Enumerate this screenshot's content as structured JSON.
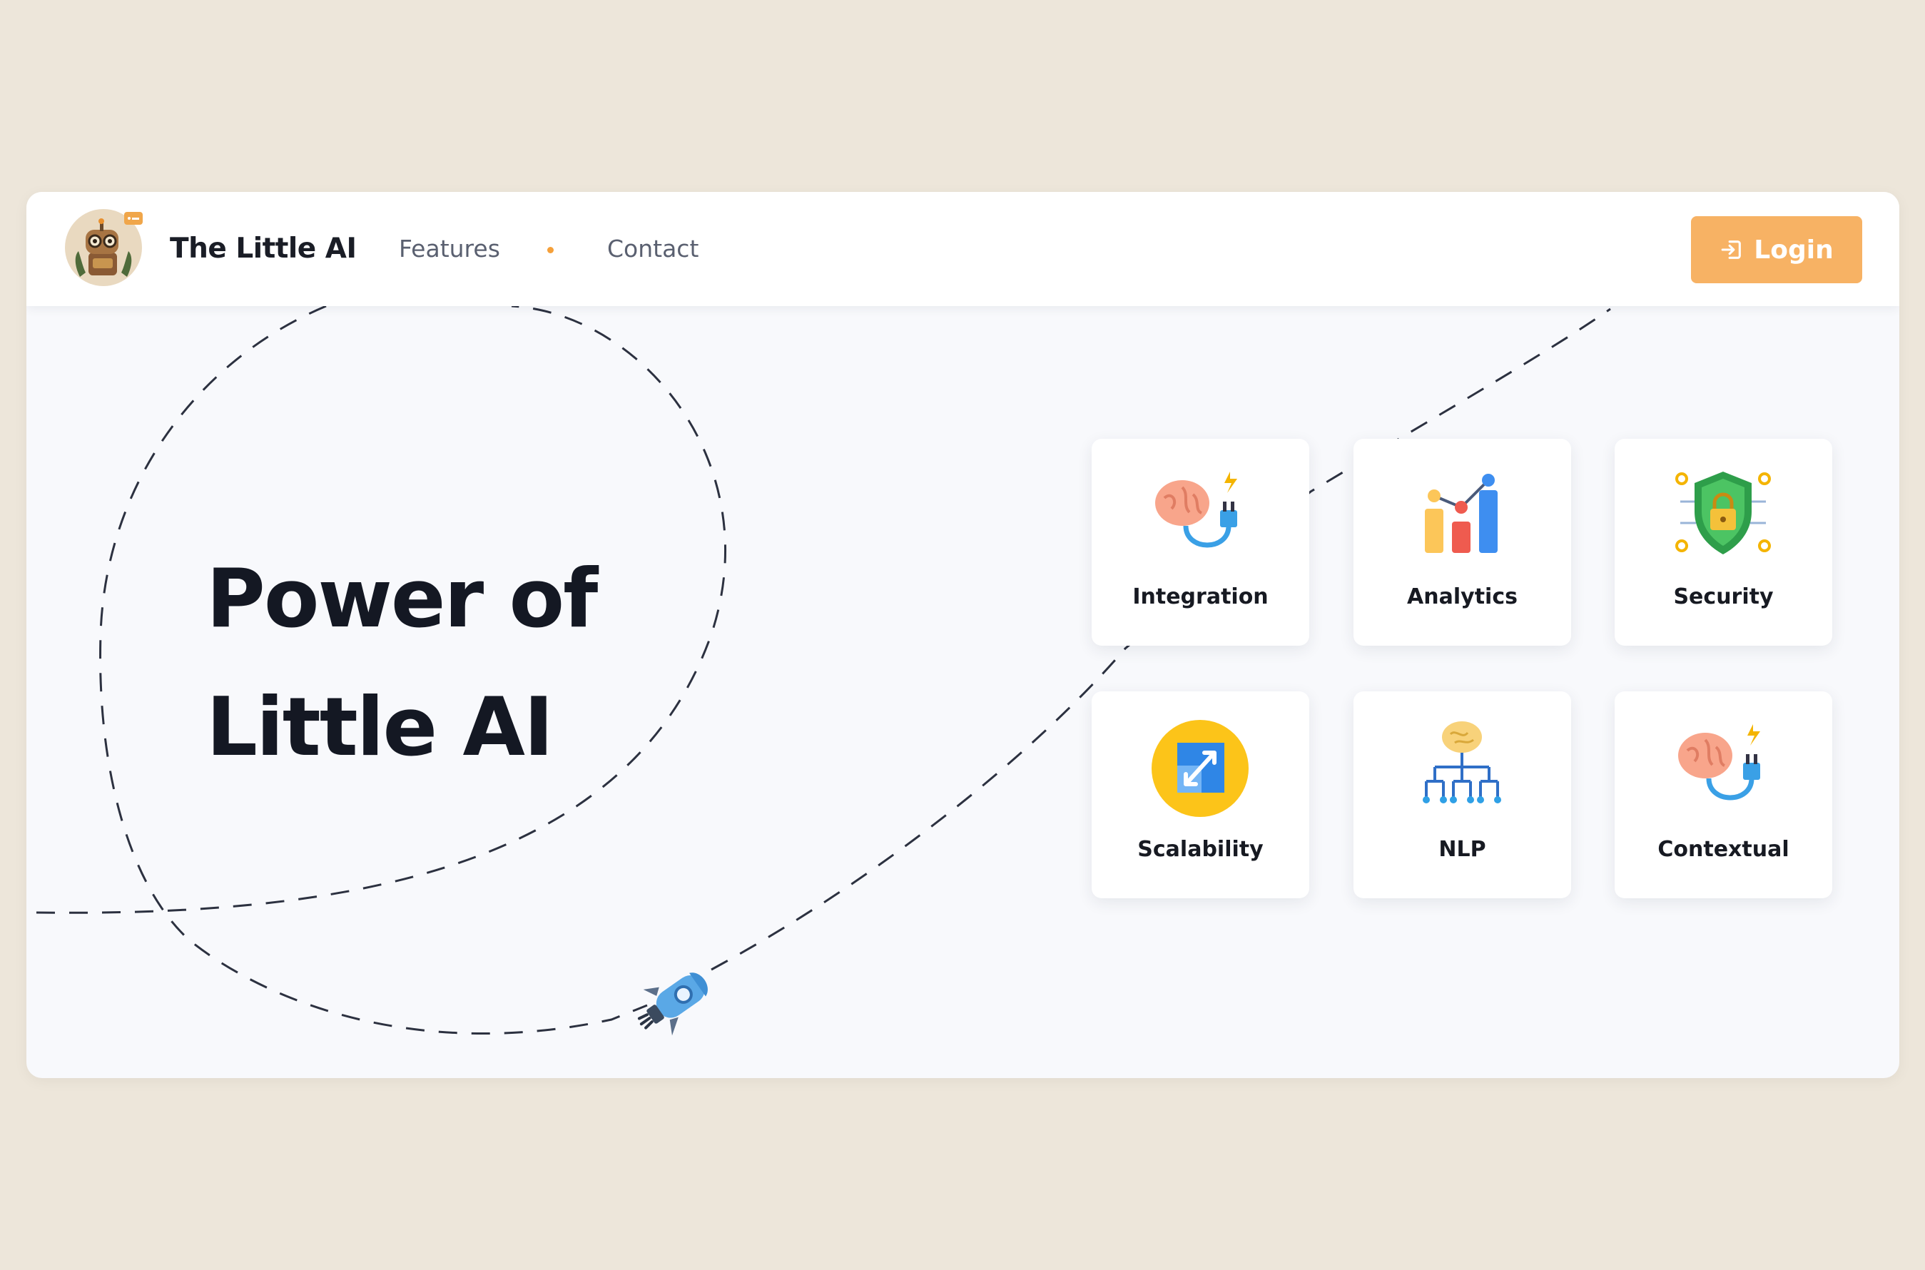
{
  "header": {
    "brand": "The Little AI",
    "nav": [
      {
        "label": "Features"
      },
      {
        "label": "Contact"
      }
    ],
    "login_label": "Login",
    "accent_color": "#f7b264"
  },
  "hero": {
    "line1": "Power of",
    "line2": "Little AI"
  },
  "features": [
    {
      "label": "Integration",
      "icon": "brain-plug-icon"
    },
    {
      "label": "Analytics",
      "icon": "bar-chart-icon"
    },
    {
      "label": "Security",
      "icon": "shield-lock-icon"
    },
    {
      "label": "Scalability",
      "icon": "expand-arrows-icon"
    },
    {
      "label": "NLP",
      "icon": "brain-network-icon"
    },
    {
      "label": "Contextual",
      "icon": "brain-plug-icon"
    }
  ],
  "colors": {
    "background": "#ede6da",
    "panel": "#f8f9fc",
    "text": "#141823",
    "nav_dot": "#f5a03a"
  }
}
